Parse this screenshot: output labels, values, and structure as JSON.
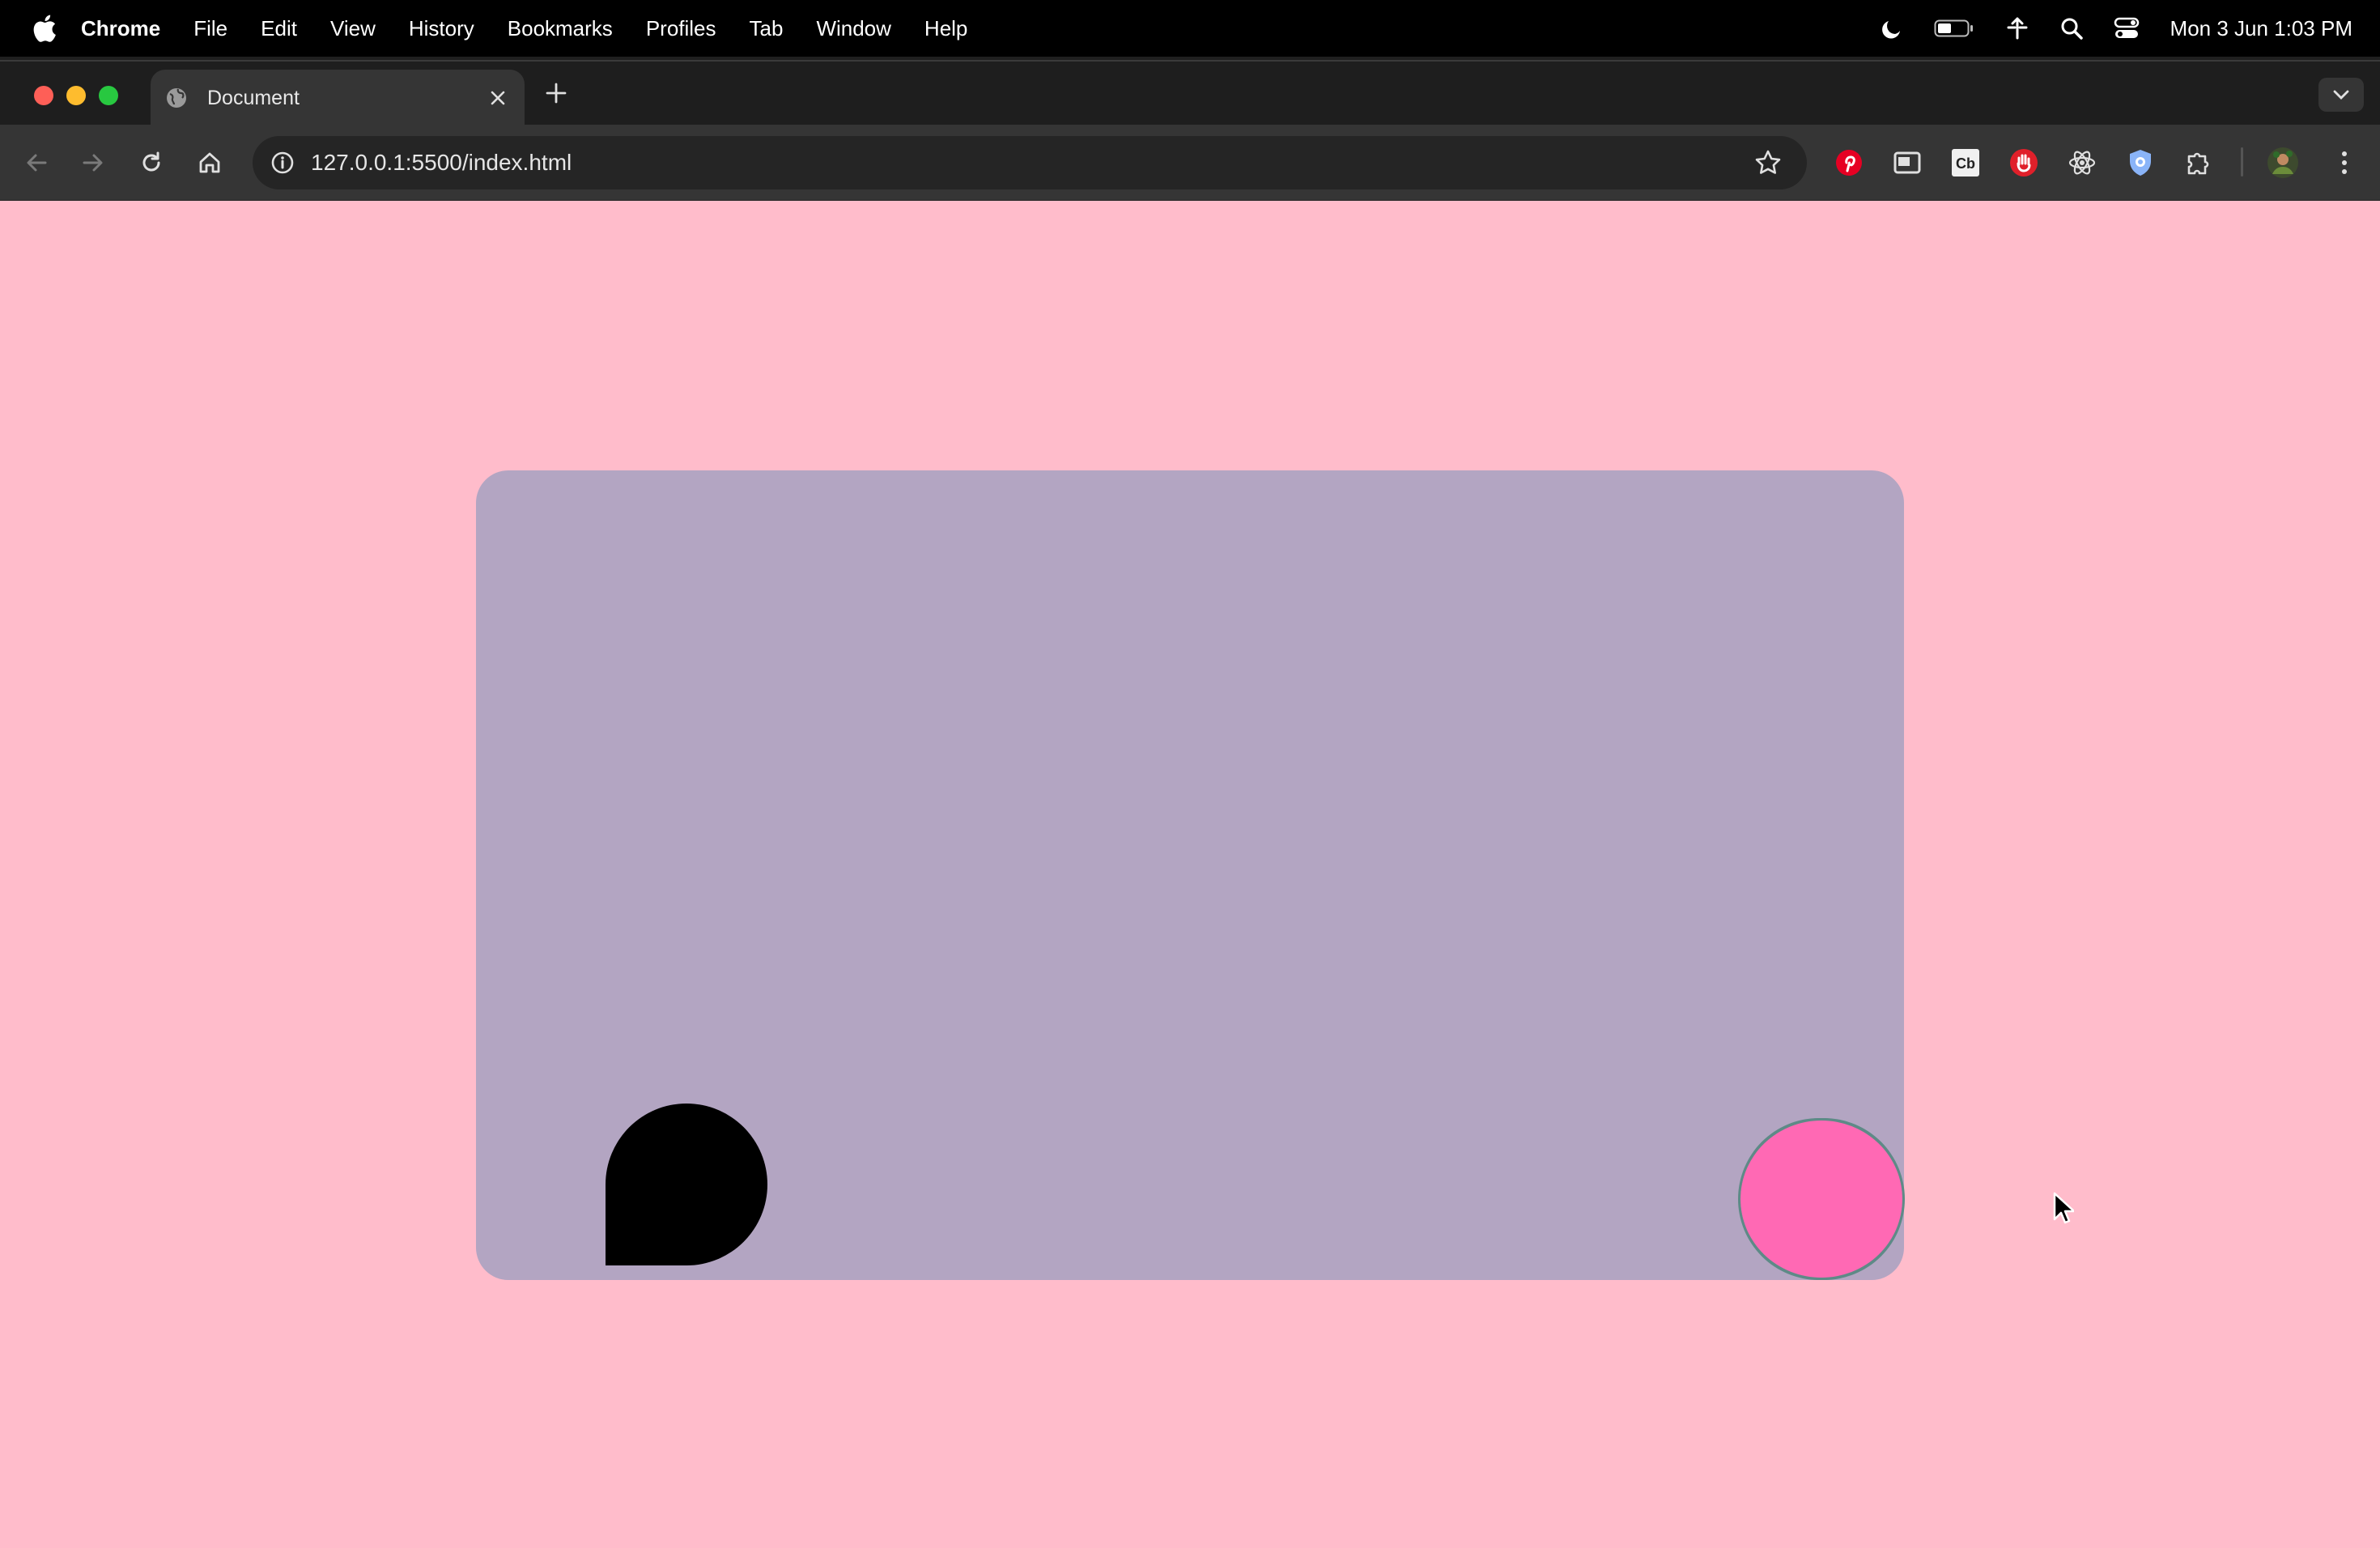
{
  "menubar": {
    "app_name": "Chrome",
    "items": [
      "File",
      "Edit",
      "View",
      "History",
      "Bookmarks",
      "Profiles",
      "Tab",
      "Window",
      "Help"
    ],
    "clock": "Mon 3 Jun  1:03 PM",
    "status_icons": [
      "moon-icon",
      "battery-icon",
      "network-icon",
      "spotlight-search-icon",
      "control-center-icon"
    ]
  },
  "browser": {
    "tab_title": "Document",
    "url": "127.0.0.1:5500/index.html",
    "extensions": [
      "pinterest-icon",
      "picture-in-picture-icon",
      "cb-extension-icon",
      "hand-stop-icon",
      "react-devtools-icon",
      "shield-icon",
      "puzzle-extensions-icon"
    ],
    "cb_label": "Cb"
  },
  "page": {
    "background_color": "#ffbccb",
    "card_color": "#b3a5c2",
    "blob_color": "#000000",
    "ball_color": "#ff69b4",
    "ball_border_color": "#5e8a87"
  }
}
